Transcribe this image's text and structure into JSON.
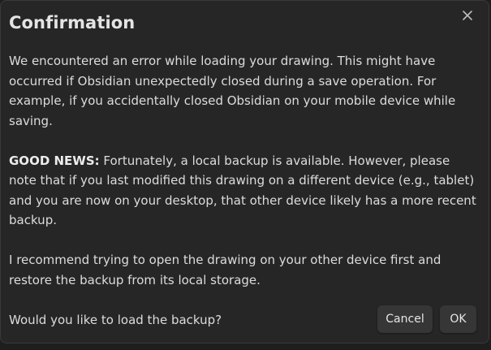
{
  "dialog": {
    "title": "Confirmation",
    "close_icon": "close-icon",
    "paragraph1": "We encountered an error while loading your drawing. This might have occurred if Obsidian unexpectedly closed during a save operation. For example, if you accidentally closed Obsidian on your mobile device while saving.",
    "paragraph2_bold": "GOOD NEWS:",
    "paragraph2_rest": " Fortunately, a local backup is available. However, please note that if you last modified this drawing on a different device (e.g., tablet) and you are now on your desktop, that other device likely has a more recent backup.",
    "paragraph3": "I recommend trying to open the drawing on your other device first and restore the backup from its local storage.",
    "paragraph4": "Would you like to load the backup?",
    "cancel_label": "Cancel",
    "ok_label": "OK"
  }
}
